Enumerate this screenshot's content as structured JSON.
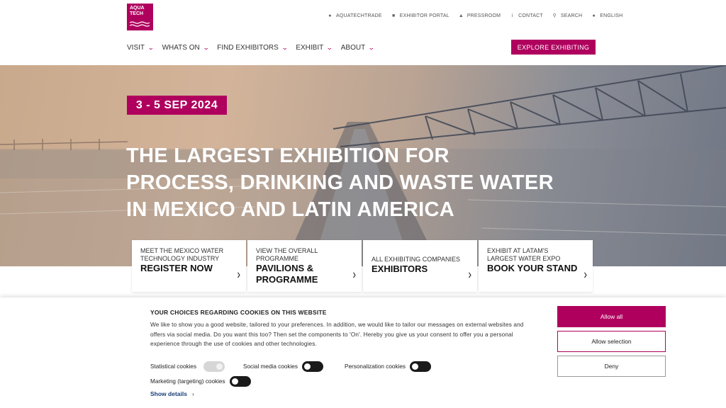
{
  "header": {
    "logo_lines": [
      "AQUA",
      "TECH"
    ],
    "utility_links": [
      {
        "icon": "globe-icon",
        "label": "AQUATECHTRADE"
      },
      {
        "icon": "lock-icon",
        "label": "EXHIBITOR PORTAL"
      },
      {
        "icon": "megaphone-icon",
        "label": "PRESSROOM"
      },
      {
        "icon": "info-icon",
        "label": "CONTACT"
      },
      {
        "icon": "search-icon",
        "label": "SEARCH"
      },
      {
        "icon": "globe-icon",
        "label": "ENGLISH"
      }
    ],
    "nav": [
      "VISIT",
      "WHATS ON",
      "FIND EXHIBITORS",
      "EXHIBIT",
      "ABOUT"
    ],
    "cta": "EXPLORE EXHIBITING"
  },
  "hero": {
    "date": "3 - 5 SEP 2024",
    "headline_lines": [
      "THE LARGEST EXHIBITION FOR",
      "PROCESS, DRINKING AND WASTE WATER",
      "IN MEXICO AND LATIN AMERICA"
    ]
  },
  "cards": [
    {
      "sub": "MEET THE MEXICO WATER TECHNOLOGY INDUSTRY",
      "big": "REGISTER NOW"
    },
    {
      "sub": "VIEW THE OVERALL PROGRAMME",
      "big": "PAVILIONS & PROGRAMME"
    },
    {
      "sub": "ALL EXHIBITING COMPANIES",
      "big": "EXHIBITORS"
    },
    {
      "sub": "EXHIBIT AT LATAM'S LARGEST WATER EXPO",
      "big": "BOOK YOUR STAND"
    }
  ],
  "cookie": {
    "title": "YOUR CHOICES REGARDING COOKIES ON THIS WEBSITE",
    "body": "We like to show you a good website, tailored to your preferences. In addition, we would like to tailor our messages on external websites and offers via social media. Do you want this too? Then set the components to 'On'. Hereby you give us your consent to offer you a personal experience through the use of cookies and other technologies.",
    "toggles": {
      "statistical": {
        "label": "Statistical cookies",
        "state": "disabled"
      },
      "social": {
        "label": "Social media cookies",
        "state": "off"
      },
      "personalization": {
        "label": "Personalization cookies",
        "state": "off"
      },
      "marketing": {
        "label": "Marketing (targeting) cookies",
        "state": "off"
      }
    },
    "show_details": "Show details",
    "buttons": {
      "allow_all": "Allow all",
      "allow_selection": "Allow selection",
      "deny": "Deny"
    }
  },
  "colors": {
    "brand": "#b0005e"
  }
}
